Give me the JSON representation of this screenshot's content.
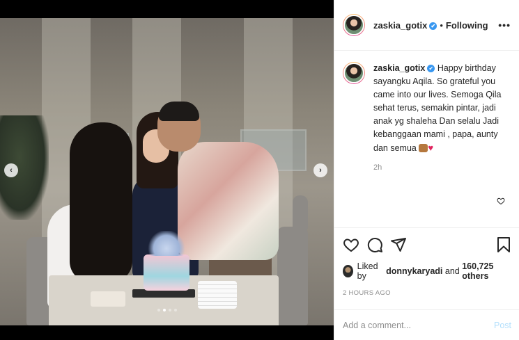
{
  "post": {
    "nav_prev": "‹",
    "nav_next": "›",
    "carousel_dots": 4,
    "active_dot": 1
  },
  "header": {
    "username": "zaskia_gotix",
    "verified_mark": "✔",
    "separator": "•",
    "follow_status": "Following",
    "more": "•••"
  },
  "caption": {
    "username": "zaskia_gotix",
    "verified_mark": "✔",
    "text": "Happy birthday sayangku Aqila. So grateful you came into our lives. Semoga Qila sehat terus, semakin pintar, jadi anak yg shaleha Dan selalu Jadi kebanggaan mami , papa, aunty dan semua",
    "emoji_heart": "♥",
    "time": "2h"
  },
  "actions": {
    "icons": [
      "heart-icon",
      "comment-icon",
      "share-icon",
      "bookmark-icon"
    ]
  },
  "likes": {
    "prefix": "Liked by",
    "user": "donnykaryadi",
    "middle": "and",
    "count": "160,725 others"
  },
  "timestamp": "2 HOURS AGO",
  "comment_box": {
    "placeholder": "Add a comment...",
    "post_label": "Post"
  },
  "colors": {
    "verified": "#3897f0",
    "post_disabled": "#b2dffc",
    "muted": "#8e8e8e",
    "text": "#262626"
  }
}
